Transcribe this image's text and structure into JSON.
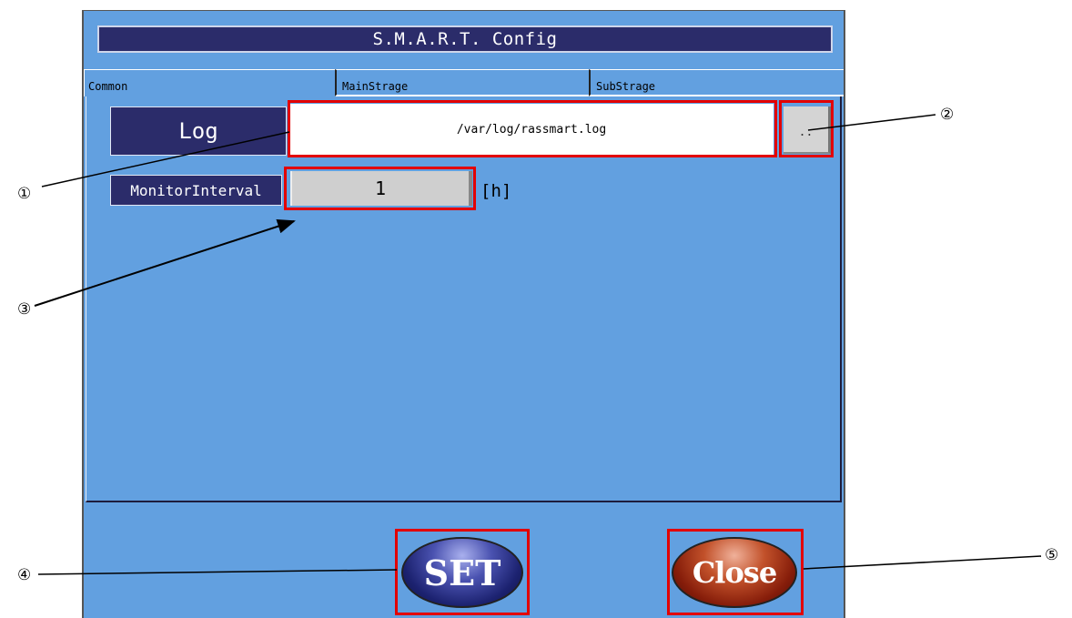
{
  "window": {
    "title": "S.M.A.R.T. Config"
  },
  "tabs": [
    {
      "label": "Common",
      "active": true
    },
    {
      "label": "MainStrage",
      "active": false
    },
    {
      "label": "SubStrage",
      "active": false
    }
  ],
  "log": {
    "label": "Log",
    "path": "/var/log/rassmart.log",
    "browse_label": ".."
  },
  "monitor": {
    "label": "MonitorInterval",
    "value": "1",
    "unit": "[h]"
  },
  "buttons": {
    "set_label": "SET",
    "close_label": "Close"
  },
  "callouts": {
    "c1": "①",
    "c2": "②",
    "c3": "③",
    "c4": "④",
    "c5": "⑤"
  },
  "colors": {
    "background": "#62a0e0",
    "label_bg": "#2b2c6a",
    "highlight": "#e30000"
  }
}
